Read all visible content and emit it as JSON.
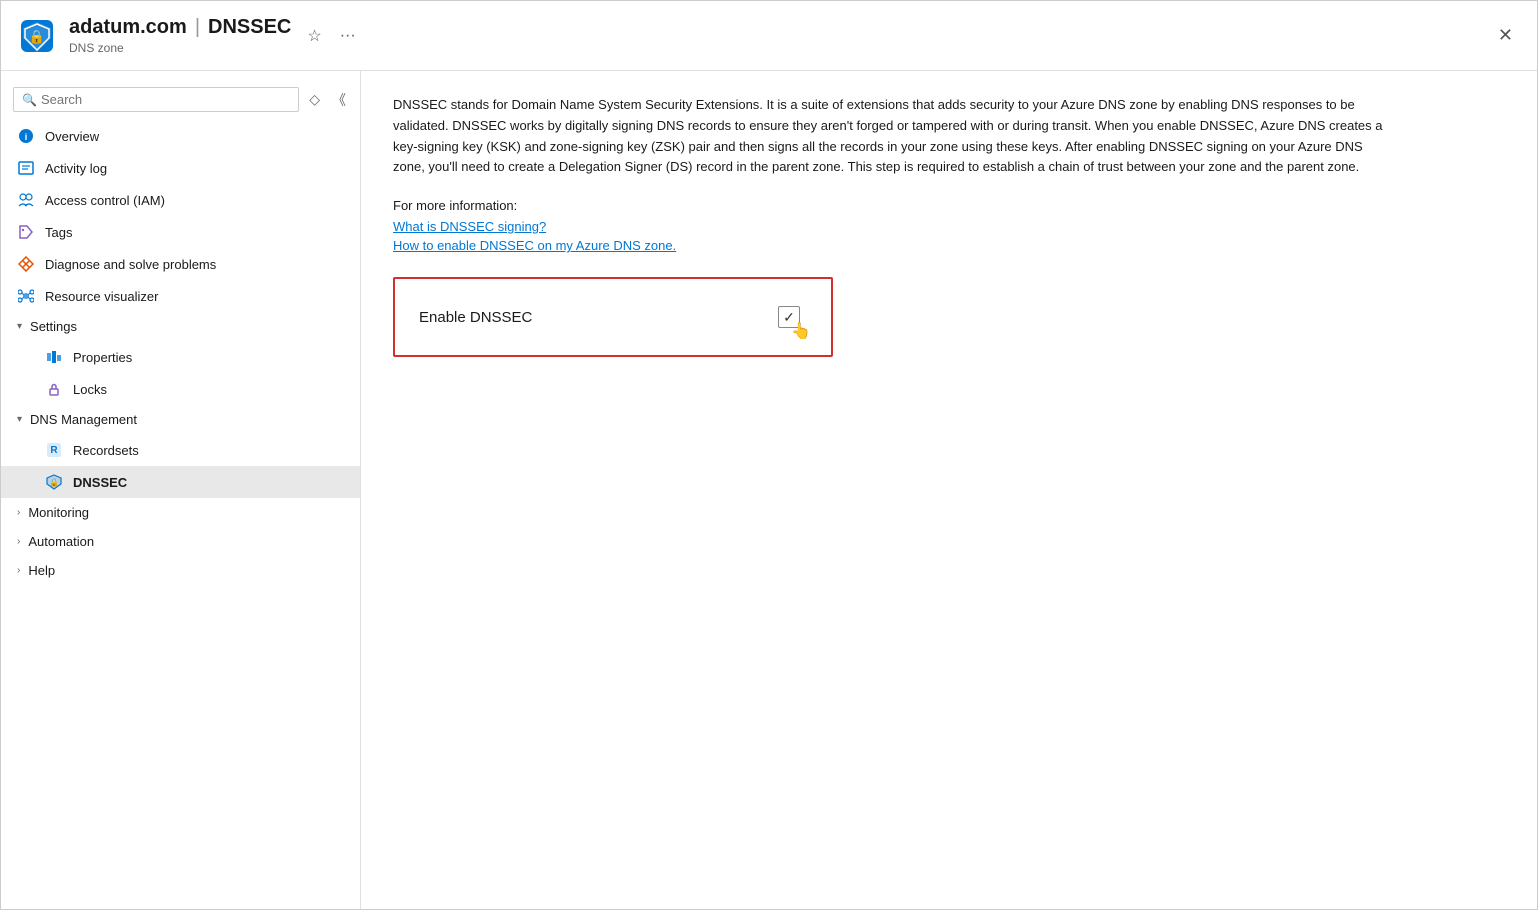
{
  "header": {
    "domain": "adatum.com",
    "separator": "|",
    "page": "DNSSEC",
    "subtitle": "DNS zone",
    "close_label": "×"
  },
  "sidebar": {
    "search_placeholder": "Search",
    "nav_items": [
      {
        "id": "overview",
        "label": "Overview",
        "icon": "overview-icon"
      },
      {
        "id": "activity-log",
        "label": "Activity log",
        "icon": "activity-icon"
      },
      {
        "id": "access-control",
        "label": "Access control (IAM)",
        "icon": "iam-icon"
      },
      {
        "id": "tags",
        "label": "Tags",
        "icon": "tags-icon"
      },
      {
        "id": "diagnose",
        "label": "Diagnose and solve problems",
        "icon": "diagnose-icon"
      },
      {
        "id": "resource-visualizer",
        "label": "Resource visualizer",
        "icon": "resource-icon"
      }
    ],
    "sections": [
      {
        "id": "settings",
        "label": "Settings",
        "expanded": true,
        "items": [
          {
            "id": "properties",
            "label": "Properties",
            "icon": "properties-icon"
          },
          {
            "id": "locks",
            "label": "Locks",
            "icon": "locks-icon"
          }
        ]
      },
      {
        "id": "dns-management",
        "label": "DNS Management",
        "expanded": true,
        "items": [
          {
            "id": "recordsets",
            "label": "Recordsets",
            "icon": "recordsets-icon"
          },
          {
            "id": "dnssec",
            "label": "DNSSEC",
            "icon": "dnssec-icon",
            "active": true
          }
        ]
      },
      {
        "id": "monitoring",
        "label": "Monitoring",
        "expanded": false,
        "items": []
      },
      {
        "id": "automation",
        "label": "Automation",
        "expanded": false,
        "items": []
      },
      {
        "id": "help",
        "label": "Help",
        "expanded": false,
        "items": []
      }
    ]
  },
  "content": {
    "description": "DNSSEC stands for Domain Name System Security Extensions. It is a suite of extensions that adds security to your Azure DNS zone by enabling DNS responses to be validated. DNSSEC works by digitally signing DNS records to ensure they aren't forged or tampered with or during transit. When you enable DNSSEC, Azure DNS creates a key-signing key (KSK) and zone-signing key (ZSK) pair and then signs all the records in your zone using these keys. After enabling DNSSEC signing on your Azure DNS zone, you'll need to create a Delegation Signer (DS) record in the parent zone. This step is required to establish a chain of trust between your zone and the parent zone.",
    "more_info_label": "For more information:",
    "links": [
      {
        "id": "what-is-dnssec",
        "text": "What is DNSSEC signing?"
      },
      {
        "id": "how-to-enable",
        "text": "How to enable DNSSEC on my Azure DNS zone."
      }
    ],
    "enable_box": {
      "label": "Enable DNSSEC"
    }
  }
}
